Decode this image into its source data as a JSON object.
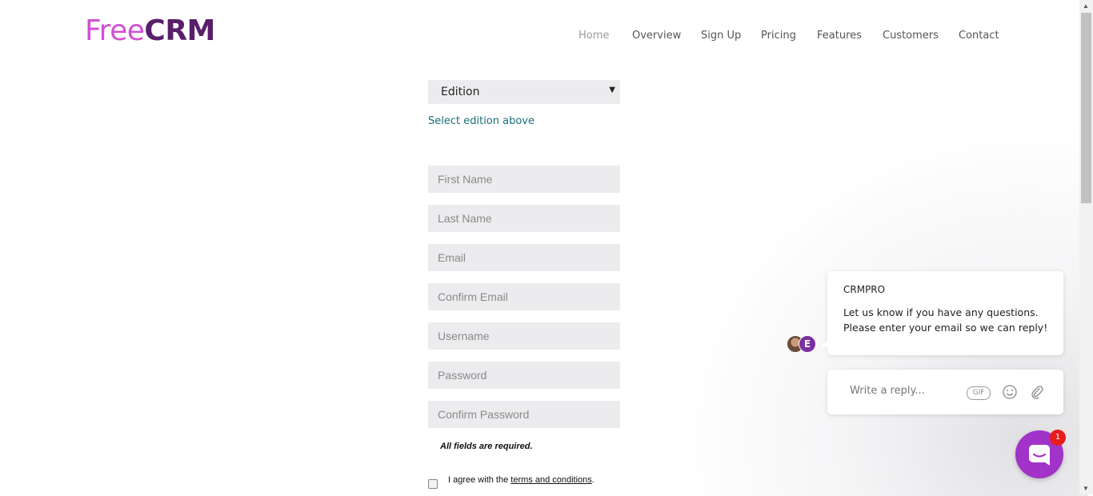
{
  "brand": {
    "logo_part1": "Free",
    "logo_part2": "CRM"
  },
  "nav": [
    {
      "label": "Home",
      "active": true
    },
    {
      "label": "Overview"
    },
    {
      "label": "Sign Up"
    },
    {
      "label": "Pricing"
    },
    {
      "label": "Features"
    },
    {
      "label": "Customers"
    },
    {
      "label": "Contact"
    }
  ],
  "form": {
    "edition_selected": "Edition",
    "edition_hint": "Select edition above",
    "fields": {
      "first_name": "First Name",
      "last_name": "Last Name",
      "email": "Email",
      "confirm_email": "Confirm Email",
      "username": "Username",
      "password": "Password",
      "confirm_password": "Confirm Password"
    },
    "required_note": "All fields are required.",
    "agree_prefix": "I agree with the ",
    "terms_link": "terms and conditions",
    "agree_suffix": "."
  },
  "chat": {
    "sender": "CRMPRO",
    "message": "Let us know if you have any questions. Please enter your email so we can reply!",
    "avatar_letter": "E",
    "reply_placeholder": "Write a reply...",
    "gif_label": "GIF",
    "icons": [
      "gif-icon",
      "emoji-icon",
      "attachment-icon"
    ],
    "launcher_badge": "1"
  },
  "colors": {
    "logo_free": "#d150d6",
    "logo_crm": "#5a1f6a",
    "launcher": "#a233c9",
    "badge": "#e81c1c",
    "hint_link": "#1a6f7a"
  }
}
